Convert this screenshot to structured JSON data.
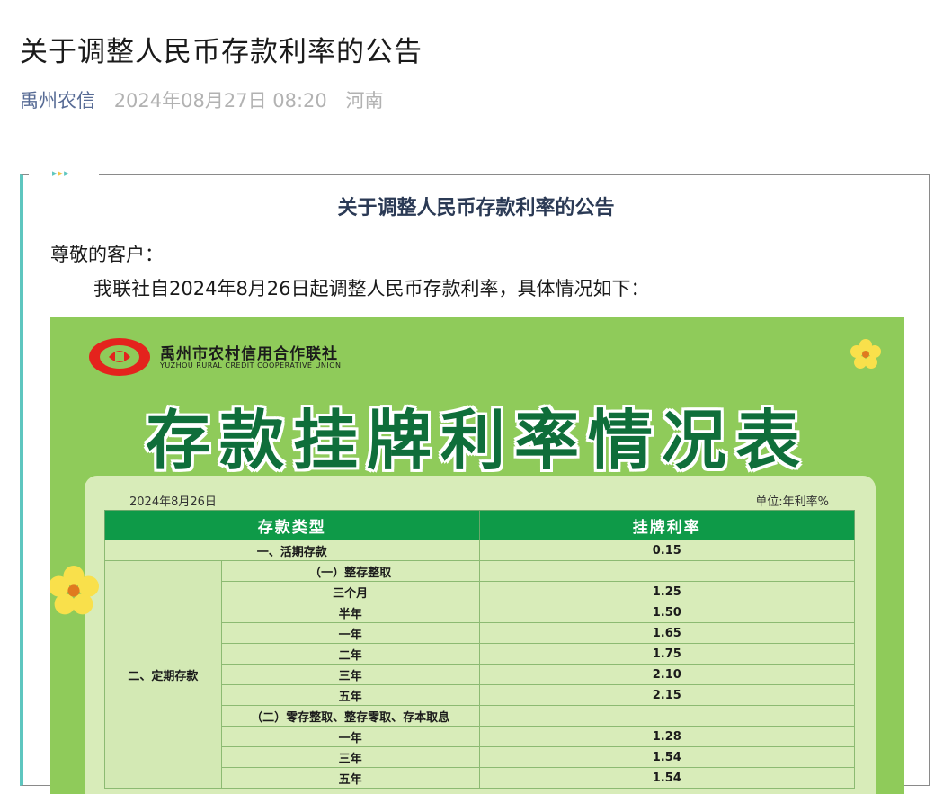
{
  "article": {
    "title": "关于调整人民币存款利率的公告",
    "author": "禹州农信",
    "date": "2024年08月27日 08:20",
    "region": "河南"
  },
  "notice": {
    "title": "关于调整人民币存款利率的公告",
    "greeting": "尊敬的客户：",
    "intro": "我联社自2024年8月26日起调整人民币存款利率，具体情况如下："
  },
  "poster": {
    "union_cn": "禹州市农村信用合作联社",
    "union_en": "YUZHOU RURAL CREDIT COOPERATIVE  UNION",
    "big_title": "存款挂牌利率情况表",
    "date": "2024年8月26日",
    "unit": "单位:年利率%",
    "header_type": "存款类型",
    "header_rate": "挂牌利率",
    "row_demand_label": "一、活期存款",
    "row_demand_rate": "0.15",
    "group_fixed": "二、定期存款",
    "sub1": "（一）整存整取",
    "sub1_rows": [
      {
        "term": "三个月",
        "rate": "1.25"
      },
      {
        "term": "半年",
        "rate": "1.50"
      },
      {
        "term": "一年",
        "rate": "1.65"
      },
      {
        "term": "二年",
        "rate": "1.75"
      },
      {
        "term": "三年",
        "rate": "2.10"
      },
      {
        "term": "五年",
        "rate": "2.15"
      }
    ],
    "sub2": "（二）零存整取、整存零取、存本取息",
    "sub2_rows": [
      {
        "term": "一年",
        "rate": "1.28"
      },
      {
        "term": "三年",
        "rate": "1.54"
      },
      {
        "term": "五年",
        "rate": "1.54"
      }
    ]
  },
  "colors": {
    "accent": "#5ec6bf",
    "author": "#576b95",
    "poster_green": "#8fcb5a",
    "header_green": "#0e9a48",
    "title_green": "#0f6e3a"
  }
}
